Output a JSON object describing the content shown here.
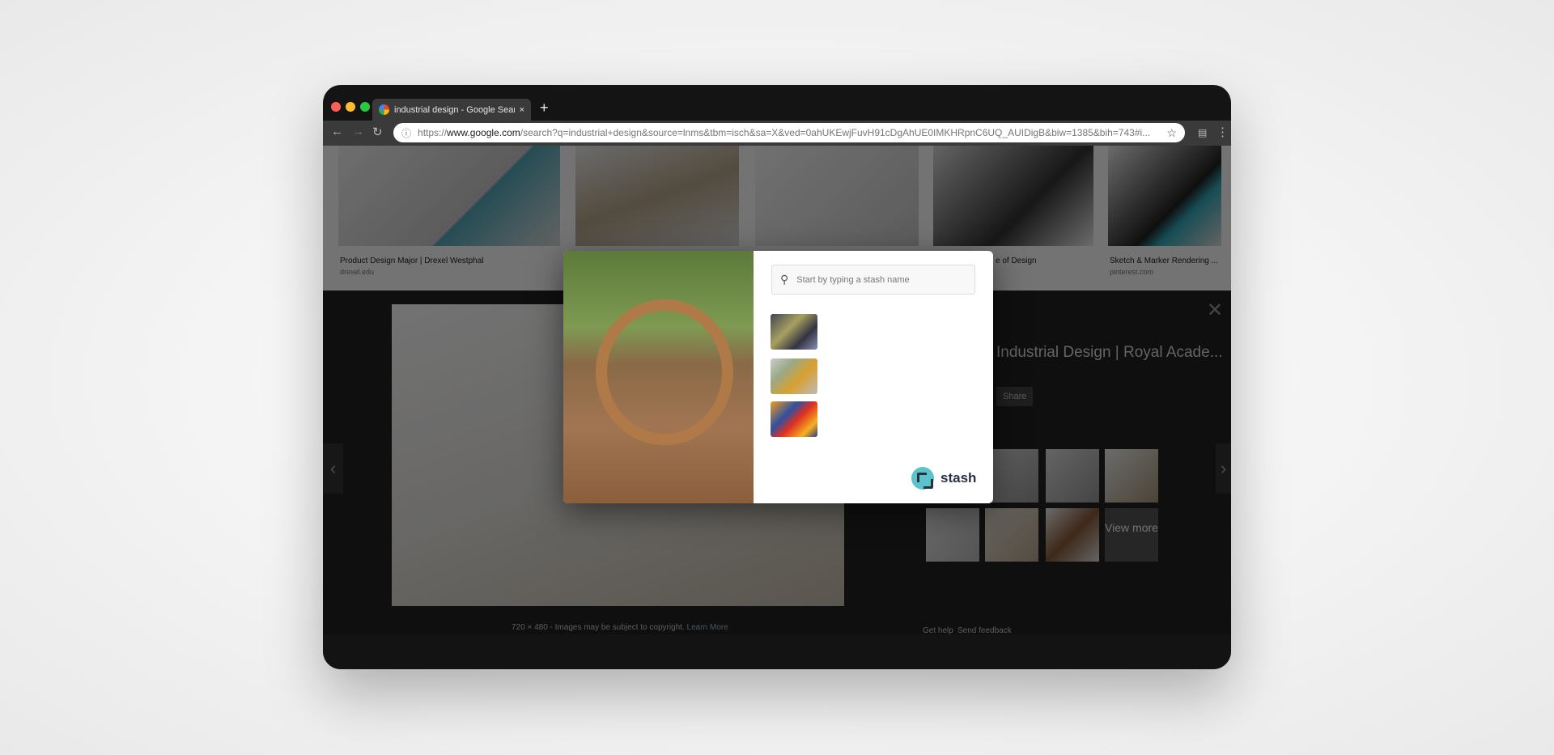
{
  "browser": {
    "tab_title": "industrial design - Google Sear",
    "new_tab": "+",
    "tab_close": "×",
    "url_prefix": "https://",
    "url_domain": "www.google.com",
    "url_rest": "/search?q=industrial+design&source=lnms&tbm=isch&sa=X&ved=0ahUKEwjFuvH91cDgAhUE0IMKHRpnC6UQ_AUIDigB&biw=1385&bih=743#i..."
  },
  "results": [
    {
      "caption": "Product Design Major | Drexel Westphal",
      "source": "drexel.edu"
    },
    {
      "caption": "",
      "source": ""
    },
    {
      "caption": "",
      "source": ""
    },
    {
      "caption": "e of Design",
      "source": ""
    },
    {
      "caption": "Sketch & Marker Rendering ...",
      "source": "pinterest.com"
    }
  ],
  "viewer": {
    "title": "Industrial Design | Royal Acade...",
    "share": "Share",
    "view_more": "View more",
    "footer": "720 × 480 - Images may be subject to copyright.",
    "learn_more": "Learn More",
    "get_help": "Get help",
    "send_feedback": "Send feedback"
  },
  "stash": {
    "placeholder": "Start by typing a stash name",
    "brand": "stash",
    "accent": "#5cc3cd"
  }
}
